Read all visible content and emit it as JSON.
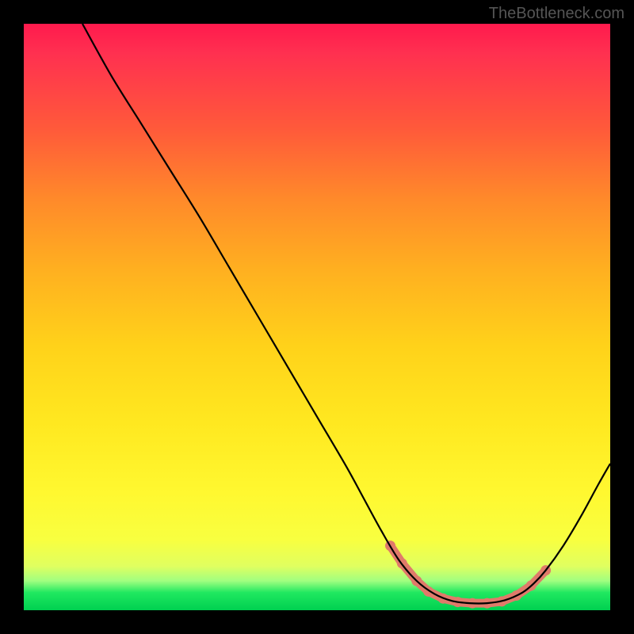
{
  "watermark": "TheBottleneck.com",
  "chart_data": {
    "type": "line",
    "title": "",
    "xlabel": "",
    "ylabel": "",
    "xlim": [
      0,
      100
    ],
    "ylim": [
      0,
      100
    ],
    "curve": {
      "description": "V-shaped bottleneck curve. Steep descent from top-left, flat minimum near bottom around x=70-85, then rises toward right edge.",
      "points": [
        {
          "x": 10.0,
          "y": 100.0
        },
        {
          "x": 15.0,
          "y": 91.0
        },
        {
          "x": 20.0,
          "y": 83.0
        },
        {
          "x": 25.0,
          "y": 75.0
        },
        {
          "x": 30.0,
          "y": 67.0
        },
        {
          "x": 35.0,
          "y": 58.5
        },
        {
          "x": 40.0,
          "y": 50.0
        },
        {
          "x": 45.0,
          "y": 41.5
        },
        {
          "x": 50.0,
          "y": 33.0
        },
        {
          "x": 55.0,
          "y": 24.5
        },
        {
          "x": 58.0,
          "y": 19.0
        },
        {
          "x": 61.0,
          "y": 13.5
        },
        {
          "x": 64.0,
          "y": 8.5
        },
        {
          "x": 67.0,
          "y": 5.0
        },
        {
          "x": 70.0,
          "y": 2.8
        },
        {
          "x": 73.0,
          "y": 1.6
        },
        {
          "x": 76.0,
          "y": 1.2
        },
        {
          "x": 79.0,
          "y": 1.2
        },
        {
          "x": 82.0,
          "y": 1.7
        },
        {
          "x": 85.0,
          "y": 3.0
        },
        {
          "x": 87.0,
          "y": 4.6
        },
        {
          "x": 89.0,
          "y": 6.8
        },
        {
          "x": 92.0,
          "y": 11.0
        },
        {
          "x": 95.0,
          "y": 16.0
        },
        {
          "x": 98.0,
          "y": 21.5
        },
        {
          "x": 100.0,
          "y": 25.0
        }
      ]
    },
    "markers": {
      "description": "Salmon colored bead markers along the valley bottom of the curve",
      "points": [
        {
          "x": 62.5,
          "y": 11.0
        },
        {
          "x": 64.5,
          "y": 8.0
        },
        {
          "x": 67.0,
          "y": 5.0
        },
        {
          "x": 69.0,
          "y": 3.2
        },
        {
          "x": 71.5,
          "y": 2.0
        },
        {
          "x": 74.0,
          "y": 1.4
        },
        {
          "x": 76.5,
          "y": 1.2
        },
        {
          "x": 79.0,
          "y": 1.2
        },
        {
          "x": 81.5,
          "y": 1.5
        },
        {
          "x": 84.0,
          "y": 2.5
        },
        {
          "x": 86.5,
          "y": 4.2
        },
        {
          "x": 89.0,
          "y": 6.8
        }
      ],
      "color": "#e07a6a"
    }
  }
}
